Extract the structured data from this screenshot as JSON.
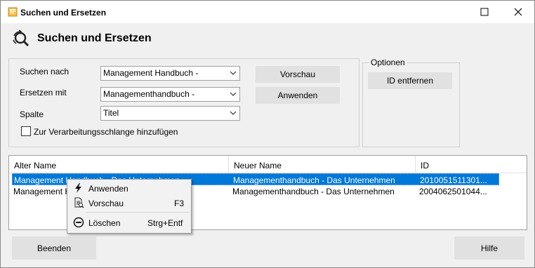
{
  "window": {
    "title": "Suchen und Ersetzen"
  },
  "heading": "Suchen und Ersetzen",
  "form": {
    "search_label": "Suchen nach",
    "search_value": "Management Handbuch -",
    "replace_label": "Ersetzen mit",
    "replace_value": "Managementhandbuch -",
    "column_label": "Spalte",
    "column_value": "Titel",
    "queue_label": "Zur Verarbeitungsschlange hinzufügen"
  },
  "buttons": {
    "preview": "Vorschau",
    "apply": "Anwenden",
    "remove_id": "ID entfernen",
    "quit": "Beenden",
    "help": "Hilfe"
  },
  "options": {
    "title": "Optionen"
  },
  "grid": {
    "columns": [
      "Alter Name",
      "Neuer Name",
      "ID"
    ],
    "rows": [
      {
        "old": "Management Handbuch -  Das Unternehmen",
        "new": "Managementhandbuch -  Das Unternehmen",
        "id": "2010051511301..."
      },
      {
        "old": "Management Handbuch -  Das Unternehmen",
        "new": "Managementhandbuch -  Das Unternehmen",
        "id": "2004062501044..."
      }
    ]
  },
  "context_menu": {
    "apply": {
      "label": "Anwenden",
      "shortcut": ""
    },
    "preview": {
      "label": "Vorschau",
      "shortcut": "F3"
    },
    "delete": {
      "label": "Löschen",
      "shortcut": "Strg+Entf"
    }
  },
  "colors": {
    "selection": "#0078d7",
    "button": "#e1e1e1",
    "background": "#f0f0f0"
  }
}
